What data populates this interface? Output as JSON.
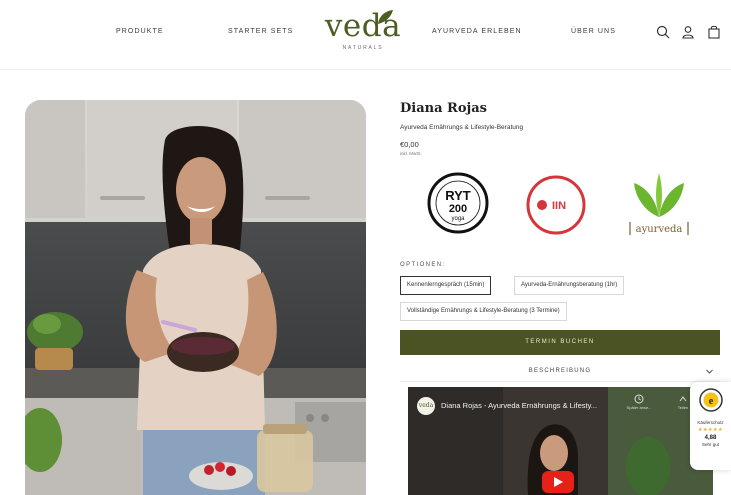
{
  "header": {
    "nav": [
      "PRODUKTE",
      "STARTER SETS",
      "AYURVEDA ERLEBEN",
      "ÜBER UNS"
    ],
    "logo_word": "veda",
    "logo_sub": "NATURALS"
  },
  "product": {
    "name": "Diana Rojas",
    "subtitle": "Ayurveda Ernährungs & Lifestyle-Beratung",
    "price": "€0,00",
    "tax_note": "inkl. MwSt."
  },
  "badges": {
    "ryt_number": "200",
    "ryt_letters": "RYT",
    "ryt_yoga": "yoga",
    "iin_text": "IIN",
    "ayurveda_text": "ayurveda"
  },
  "options": {
    "label": "OPTIONEN:",
    "items": [
      "Kennenlerngespräch (15min)",
      "Ayurveda-Ernährungsberatung (1hr)",
      "Vollständige Ernährungs & Lifestyle-Beratung (3 Termine)"
    ],
    "selected_index": 0
  },
  "book_button": "TERMIN BUCHEN",
  "description_label": "BESCHREIBUNG",
  "video": {
    "channel": "veda",
    "title": "Diana Rojas - Ayurveda Ernährungs & Lifesty...",
    "controls": [
      "Später anse...",
      "Teilen"
    ]
  },
  "trust_widget": {
    "label": "Käuferschutz",
    "stars": "★★★★★",
    "score": "4,88",
    "rating": "Sehr gut"
  },
  "colors": {
    "brand_green": "#4b5e23",
    "button_olive": "#4b5322",
    "iin_red": "#d4363b",
    "youtube_red": "#e62117"
  }
}
